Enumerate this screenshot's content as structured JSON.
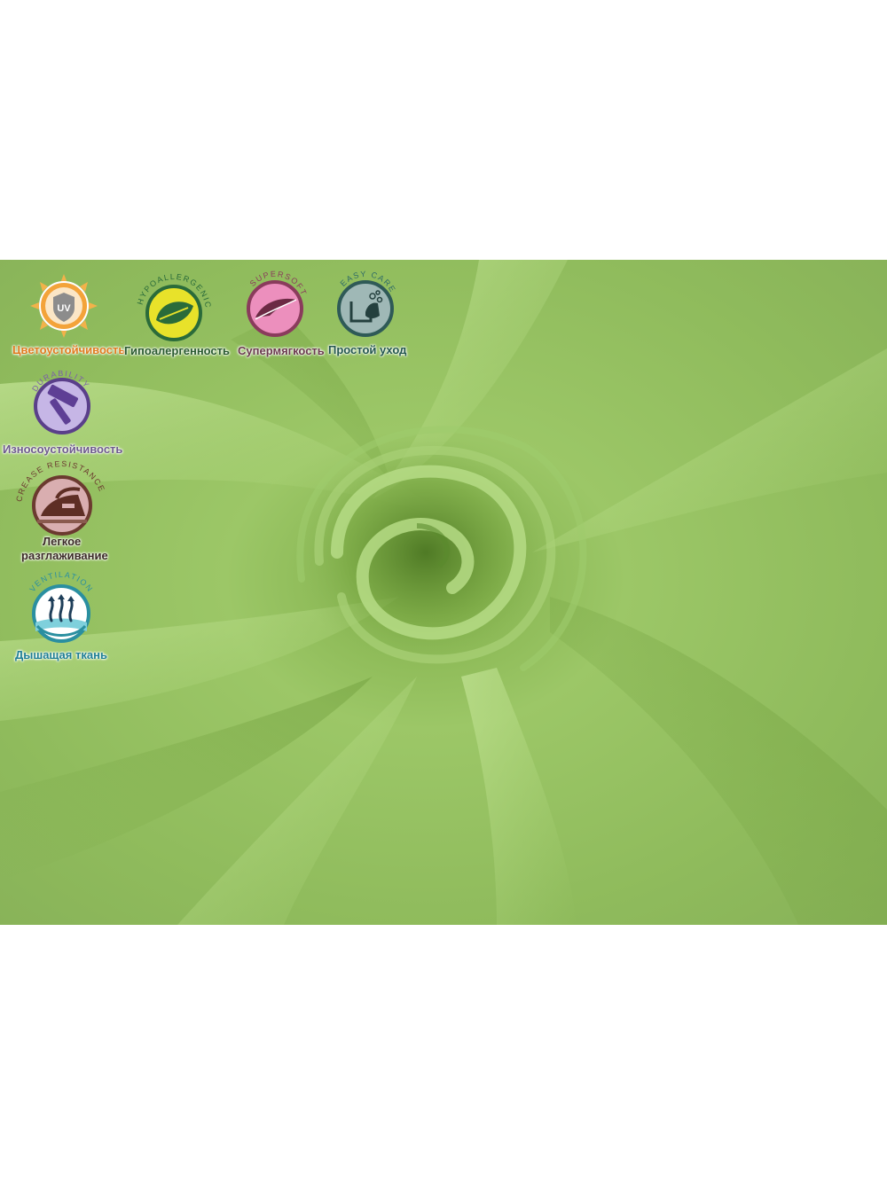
{
  "colors": {
    "fabric": "#93bf5c",
    "fabric_light": "#b4d984",
    "fabric_dark": "#6f9a3c",
    "uv": "#e07b1f",
    "hypo": "#2a6b3a",
    "supersoft": "#8a3b5c",
    "easycare": "#2f6b67",
    "durability": "#7b5fa8",
    "crease": "#6b3a2f",
    "ventilation": "#2a8fa0"
  },
  "features": [
    {
      "id": "uv",
      "icon": "uv-sun-icon",
      "badge_text": "UV",
      "label": "Цветоустойчивость"
    },
    {
      "id": "hypo",
      "icon": "leaf-icon",
      "ring_text": "HYPOALLERGENIC",
      "label": "Гипоалергенность"
    },
    {
      "id": "supersoft",
      "icon": "feather-icon",
      "ring_text": "SUPERSOFT",
      "label": "Супермягкость"
    },
    {
      "id": "easycare",
      "icon": "hand-wash-icon",
      "ring_text": "EASY CARE",
      "label": "Простой уход"
    },
    {
      "id": "durability",
      "icon": "hammer-icon",
      "ring_text": "DURABILITY",
      "label": "Износоустойчивость"
    },
    {
      "id": "crease",
      "icon": "iron-icon",
      "ring_text": "CREASE RESISTANCE",
      "label_line1": "Легкое",
      "label_line2": "разглаживание"
    },
    {
      "id": "ventilation",
      "icon": "ventilation-icon",
      "ring_text": "VENTILATION",
      "label": "Дышащая ткань"
    }
  ]
}
